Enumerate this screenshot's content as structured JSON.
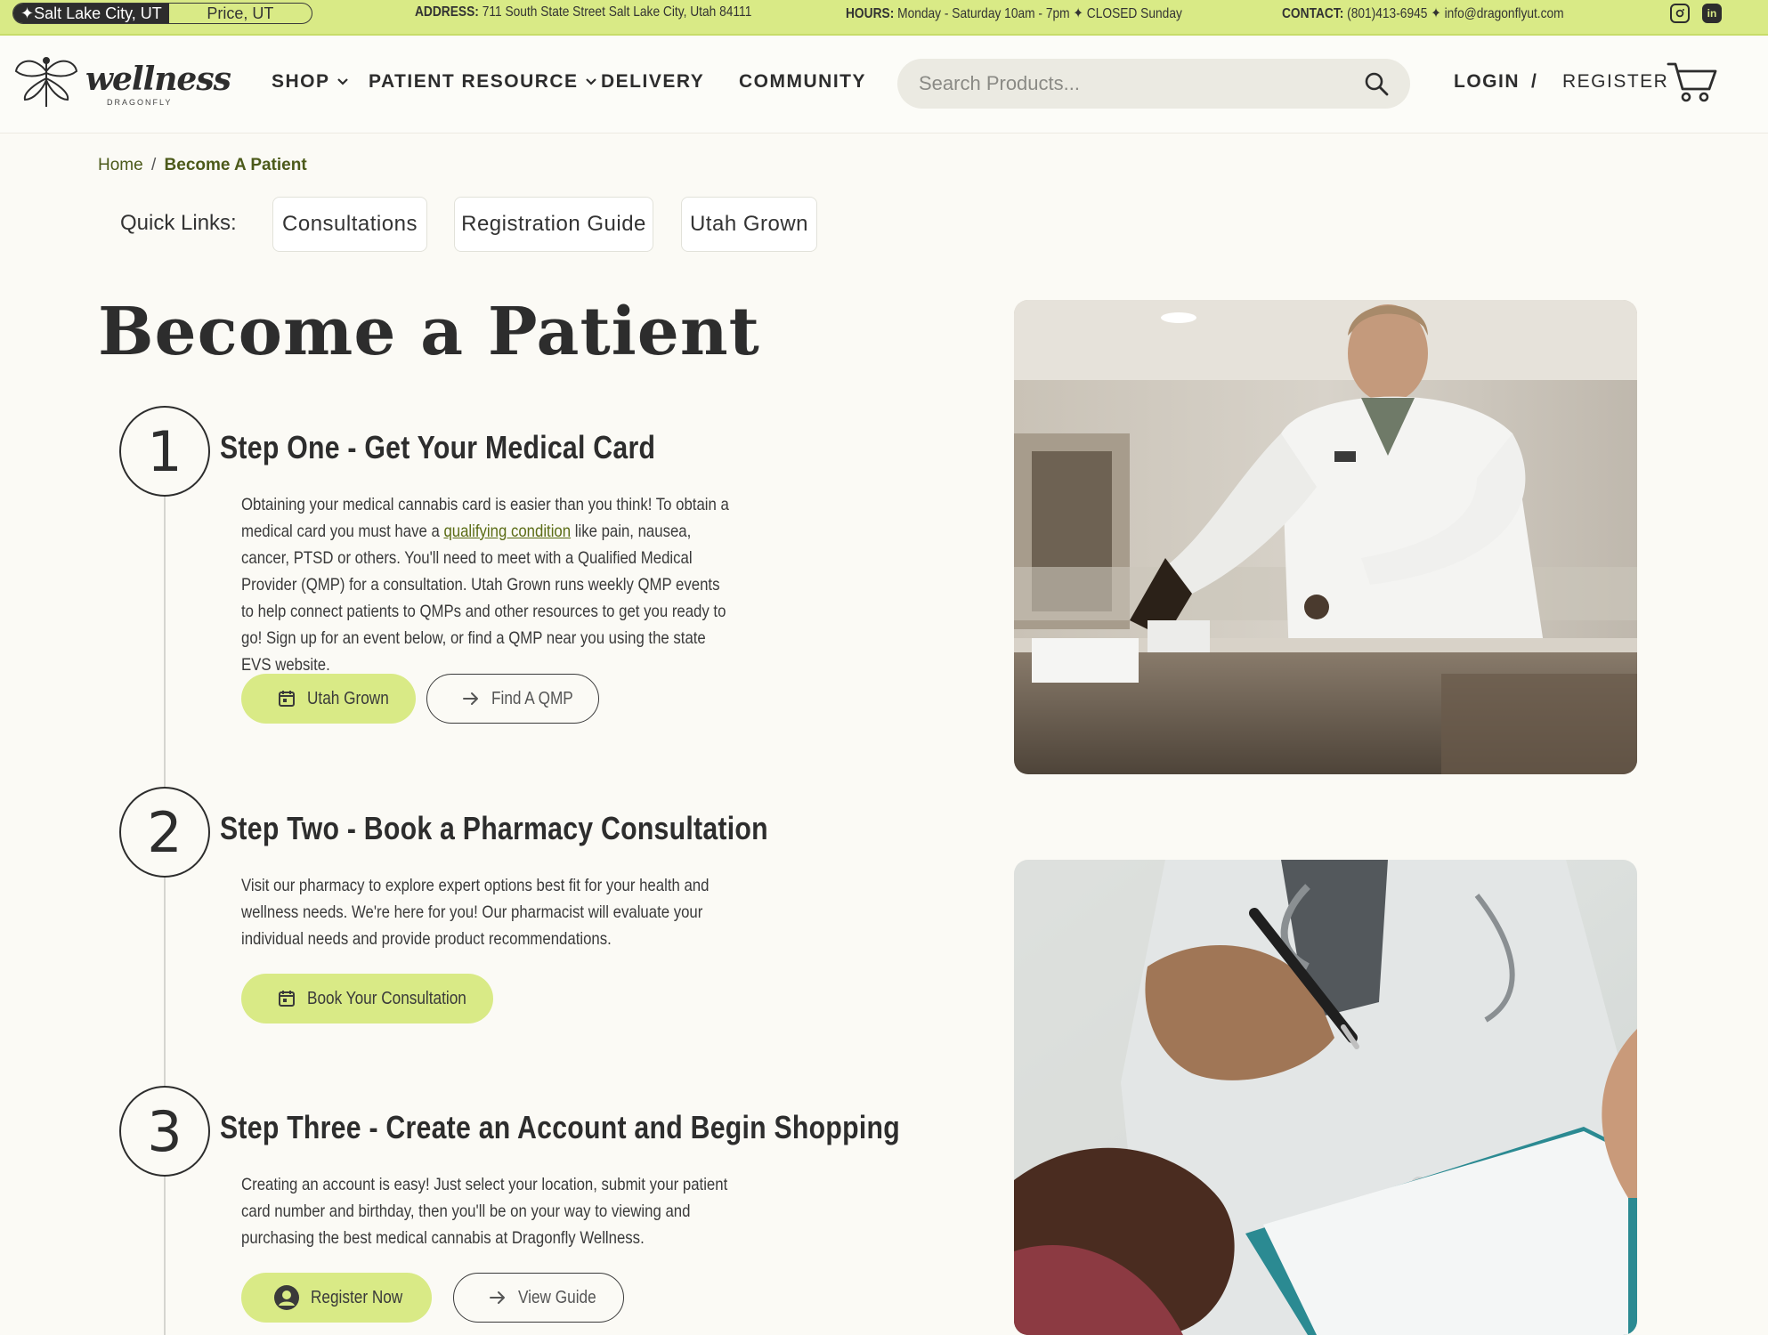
{
  "topbar": {
    "location_active": "✦Salt Lake City, UT",
    "location_other": "Price, UT",
    "address_label": "ADDRESS:",
    "address_value": "711 South State Street Salt Lake City, Utah 84111",
    "hours_label": "HOURS:",
    "hours_value": "Monday - Saturday 10am - 7pm ✦ CLOSED Sunday",
    "contact_label": "CONTACT:",
    "contact_value": "(801)413-6945 ✦ info@dragonflyut.com",
    "social": [
      "instagram-icon",
      "linkedin-icon"
    ],
    "linkedin_glyph": "in"
  },
  "nav": {
    "logo_text": "wellness",
    "logo_sub": "DRAGONFLY",
    "items": [
      {
        "label": "SHOP",
        "has_dropdown": true
      },
      {
        "label": "PATIENT RESOURCE",
        "has_dropdown": true
      },
      {
        "label": "DELIVERY",
        "has_dropdown": false
      },
      {
        "label": "COMMUNITY",
        "has_dropdown": false
      }
    ],
    "search_placeholder": "Search Products...",
    "login": "LOGIN",
    "slash": "/",
    "register": "REGISTER"
  },
  "breadcrumb": {
    "home": "Home",
    "separator": "/",
    "current": "Become A Patient"
  },
  "quick_links": {
    "label": "Quick Links:",
    "items": [
      "Consultations",
      "Registration Guide",
      "Utah Grown"
    ]
  },
  "page_title": "Become a Patient",
  "steps": [
    {
      "number": "1",
      "title": "Step One - Get Your Medical Card",
      "text_before_link": "Obtaining your medical cannabis card is easier than you think! To obtain a medical card you must have a ",
      "link_text": "qualifying condition",
      "text_after_link": " like pain, nausea, cancer, PTSD or others. You'll need to meet with a Qualified Medical Provider (QMP) for a consultation. Utah Grown runs weekly QMP events to help connect patients to QMPs and other resources to get you ready to go! Sign up for an event below, or find a QMP near you using the state EVS website.",
      "buttons": [
        {
          "label": "Utah Grown",
          "style": "primary",
          "icon": "calendar-icon"
        },
        {
          "label": "Find A QMP",
          "style": "outline",
          "icon": "arrow-right-icon"
        }
      ]
    },
    {
      "number": "2",
      "title": "Step Two - Book a Pharmacy Consultation",
      "text": "Visit our pharmacy to explore expert options best fit for your health and wellness needs. We're here for you! Our pharmacist will evaluate your individual needs and provide product recommendations.",
      "buttons": [
        {
          "label": "Book Your Consultation",
          "style": "primary",
          "icon": "calendar-icon"
        }
      ]
    },
    {
      "number": "3",
      "title": "Step Three - Create an Account and Begin Shopping",
      "text": "Creating an account is easy! Just select your location, submit your patient card number and birthday, then you'll be on your way to viewing and purchasing the best medical cannabis at Dragonfly Wellness.",
      "buttons": [
        {
          "label": "Register Now",
          "style": "primary",
          "icon": "user-icon"
        },
        {
          "label": "View Guide",
          "style": "outline",
          "icon": "arrow-right-icon"
        }
      ]
    }
  ],
  "colors": {
    "accent": "#d9ea86",
    "link": "#5a6b14",
    "text_dark": "#2d2d2d",
    "background": "#fbfaf5"
  }
}
